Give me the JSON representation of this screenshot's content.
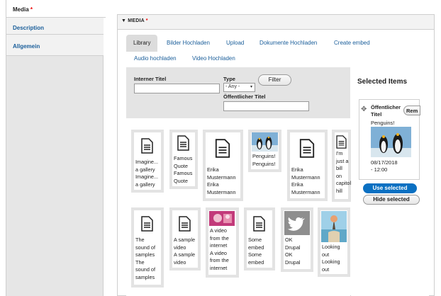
{
  "vertical_tabs": {
    "media": "Media",
    "required_mark": "*",
    "description": "Description",
    "allgemein": "Allgemein"
  },
  "section": {
    "title": "MEDIA",
    "required_mark": "*"
  },
  "tabs": [
    "Library",
    "Bilder Hochladen",
    "Upload",
    "Dokumente Hochladen",
    "Create embed",
    "Audio hochladen",
    "Video Hochladen"
  ],
  "filters": {
    "internal_title_label": "Interner Titel",
    "internal_title_value": "",
    "type_label": "Type",
    "type_value": "- Any -",
    "public_title_label": "Öffentlicher Titel",
    "public_title_value": "",
    "filter_button": "Filter"
  },
  "media_items": [
    {
      "icon": "document-icon",
      "caption": [
        "Imagine...",
        "a gallery",
        "Imagine...",
        "a gallery"
      ]
    },
    {
      "icon": "document-icon",
      "caption": [
        "Famous",
        "Quote",
        "Famous",
        "Quote"
      ]
    },
    {
      "icon": "document-icon",
      "caption": [
        "Erika",
        "Mustermann",
        "Erika",
        "Mustermann"
      ]
    },
    {
      "icon": "penguin-photo",
      "caption": [
        "Penguins!",
        "Penguins!"
      ]
    },
    {
      "icon": "document-icon",
      "caption": [
        "Erika",
        "Mustermann",
        "Erika",
        "Mustermann"
      ]
    },
    {
      "icon": "document-icon",
      "caption": [
        "I'm",
        "just a",
        "bill",
        "on",
        "capitol",
        "hill"
      ]
    },
    {
      "icon": "document-icon",
      "caption": [
        "The",
        "sound of",
        "samples",
        "The",
        "sound of",
        "samples"
      ]
    },
    {
      "icon": "document-icon",
      "caption": [
        "A sample",
        "video",
        "A sample",
        "video"
      ]
    },
    {
      "icon": "video-thumbnail",
      "caption": [
        "A video",
        "from the",
        "internet",
        "A video",
        "from the",
        "internet"
      ]
    },
    {
      "icon": "document-icon",
      "caption": [
        "Some",
        "embed",
        "Some",
        "embed"
      ]
    },
    {
      "icon": "twitter-icon",
      "caption": [
        "OK",
        "Drupal",
        "OK",
        "Drupal"
      ]
    },
    {
      "icon": "beach-photo",
      "caption": [
        "Looking",
        "out",
        "Looking",
        "out"
      ]
    }
  ],
  "selected": {
    "title": "Selected Items",
    "item_title": [
      "Öffentlicher",
      "Titel"
    ],
    "item_subtitle": "Penguins!",
    "remove_label": "Rem",
    "date": [
      "08/17/2018",
      "- 12:00"
    ],
    "use_button": "Use selected",
    "hide_button": "Hide selected"
  },
  "colors": {
    "link": "#1a5e9a",
    "primary_button": "#0a70c2",
    "required": "#e00000"
  }
}
